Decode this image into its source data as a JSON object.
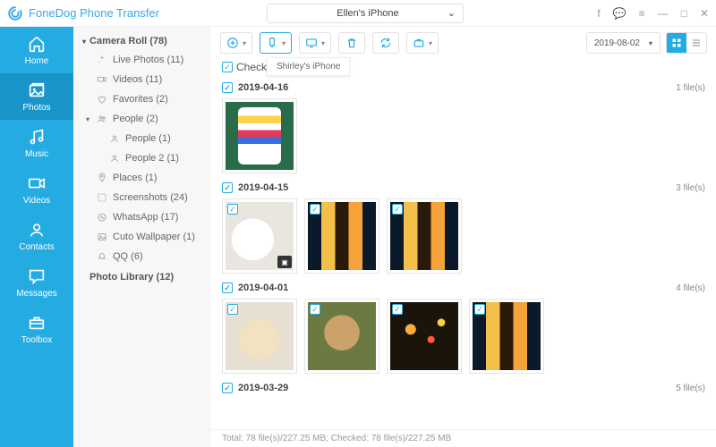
{
  "app": {
    "title": "FoneDog Phone Transfer"
  },
  "device": {
    "name": "Ellen's iPhone"
  },
  "nav": [
    {
      "key": "home",
      "label": "Home"
    },
    {
      "key": "photos",
      "label": "Photos"
    },
    {
      "key": "music",
      "label": "Music"
    },
    {
      "key": "videos",
      "label": "Videos"
    },
    {
      "key": "contacts",
      "label": "Contacts"
    },
    {
      "key": "messages",
      "label": "Messages"
    },
    {
      "key": "toolbox",
      "label": "Toolbox"
    }
  ],
  "nav_active": "photos",
  "sidebar": {
    "camera_roll": "Camera Roll (78)",
    "items": [
      {
        "icon": "sparkle",
        "label": "Live Photos (11)"
      },
      {
        "icon": "video",
        "label": "Videos (11)"
      },
      {
        "icon": "heart",
        "label": "Favorites (2)"
      },
      {
        "icon": "people",
        "label": "People (2)",
        "expanded": true
      },
      {
        "icon": "person",
        "label": "People (1)",
        "sub": true
      },
      {
        "icon": "person",
        "label": "People 2 (1)",
        "sub": true
      },
      {
        "icon": "pin",
        "label": "Places (1)"
      },
      {
        "icon": "screenshot",
        "label": "Screenshots (24)"
      },
      {
        "icon": "whatsapp",
        "label": "WhatsApp (17)"
      },
      {
        "icon": "image",
        "label": "Cuto Wallpaper (1)"
      },
      {
        "icon": "qq",
        "label": "QQ (6)"
      }
    ],
    "photo_library": "Photo Library (12)"
  },
  "toolbar": {
    "tooltip": "Shirley's iPhone",
    "date": "2019-08-02"
  },
  "checkall": "Check All(78)",
  "groups": [
    {
      "date": "2019-04-16",
      "count": "1 file(s)",
      "thumbs": [
        {
          "cls": "ph-phone"
        }
      ]
    },
    {
      "date": "2019-04-15",
      "count": "3 file(s)",
      "thumbs": [
        {
          "cls": "ph-cup",
          "video": true
        },
        {
          "cls": "ph-beer"
        },
        {
          "cls": "ph-beer"
        }
      ]
    },
    {
      "date": "2019-04-01",
      "count": "4 file(s)",
      "thumbs": [
        {
          "cls": "ph-pup1"
        },
        {
          "cls": "ph-pup2"
        },
        {
          "cls": "ph-lights"
        },
        {
          "cls": "ph-beer"
        }
      ]
    },
    {
      "date": "2019-03-29",
      "count": "5 file(s)",
      "thumbs": []
    }
  ],
  "status": "Total: 78 file(s)/227.25 MB; Checked: 78 file(s)/227.25 MB"
}
